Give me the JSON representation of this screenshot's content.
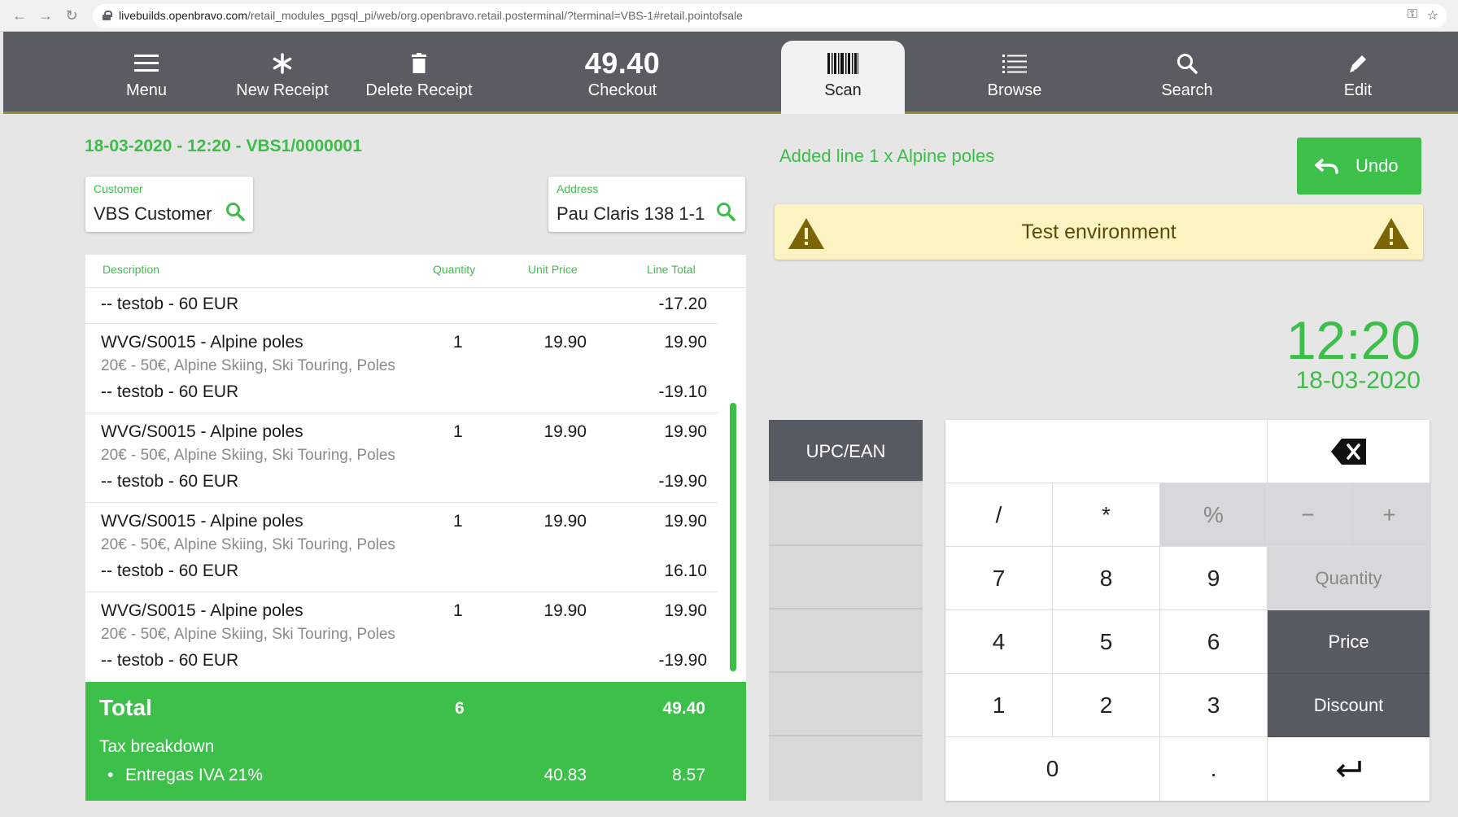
{
  "browser": {
    "url_host": "livebuilds.openbravo.com",
    "url_path": "/retail_modules_pgsql_pi/web/org.openbravo.retail.posterminal/?terminal=VBS-1#retail.pointofsale"
  },
  "toolbar": {
    "menu_label": "Menu",
    "new_receipt_label": "New Receipt",
    "delete_receipt_label": "Delete Receipt",
    "checkout_amount": "49.40",
    "checkout_label": "Checkout",
    "scan_label": "Scan",
    "browse_label": "Browse",
    "search_label": "Search",
    "edit_label": "Edit",
    "accent_color": "#9b8a39"
  },
  "receipt": {
    "id": "18-03-2020 - 12:20 - VBS1/0000001",
    "customer_label": "Customer",
    "customer_value": "VBS Customer",
    "address_label": "Address",
    "address_value": "Pau Claris 138 1-1"
  },
  "lines": {
    "headers": {
      "description": "Description",
      "quantity": "Quantity",
      "unit_price": "Unit Price",
      "line_total": "Line Total"
    },
    "first_discount": {
      "label": "-- testob - 60 EUR",
      "amount": "-17.20"
    },
    "rows": [
      {
        "product": "WVG/S0015 - Alpine poles",
        "qty": "1",
        "price": "19.90",
        "total": "19.90",
        "attrs": "20€ - 50€, Alpine Skiing, Ski Touring, Poles",
        "discount": "-- testob - 60 EUR",
        "discount_amount": "-19.10"
      },
      {
        "product": "WVG/S0015 - Alpine poles",
        "qty": "1",
        "price": "19.90",
        "total": "19.90",
        "attrs": "20€ - 50€, Alpine Skiing, Ski Touring, Poles",
        "discount": "-- testob - 60 EUR",
        "discount_amount": "-19.90"
      },
      {
        "product": "WVG/S0015 - Alpine poles",
        "qty": "1",
        "price": "19.90",
        "total": "19.90",
        "attrs": "20€ - 50€, Alpine Skiing, Ski Touring, Poles",
        "discount": "-- testob - 60 EUR",
        "discount_amount": "16.10"
      },
      {
        "product": "WVG/S0015 - Alpine poles",
        "qty": "1",
        "price": "19.90",
        "total": "19.90",
        "attrs": "20€ - 50€, Alpine Skiing, Ski Touring, Poles",
        "discount": "-- testob - 60 EUR",
        "discount_amount": "-19.90"
      }
    ]
  },
  "total": {
    "label": "Total",
    "quantity": "6",
    "amount": "49.40",
    "tax_breakdown_label": "Tax breakdown",
    "tax_name": "Entregas IVA 21%",
    "tax_base": "40.83",
    "tax_amount": "8.57",
    "color": "#3cc04a"
  },
  "message": {
    "added_line": "Added line 1 x Alpine poles"
  },
  "undo": {
    "label": "Undo"
  },
  "test_env": {
    "label": "Test environment"
  },
  "clock": {
    "time": "12:20",
    "date": "18-03-2020"
  },
  "keypad": {
    "mode_label": "UPC/EAN",
    "keys": {
      "slash": "/",
      "star": "*",
      "percent": "%",
      "minus": "−",
      "plus": "+",
      "seven": "7",
      "eight": "8",
      "nine": "9",
      "four": "4",
      "five": "5",
      "six": "6",
      "one": "1",
      "two": "2",
      "three": "3",
      "zero": "0",
      "dot": "."
    },
    "quantity_label": "Quantity",
    "price_label": "Price",
    "discount_label": "Discount"
  }
}
